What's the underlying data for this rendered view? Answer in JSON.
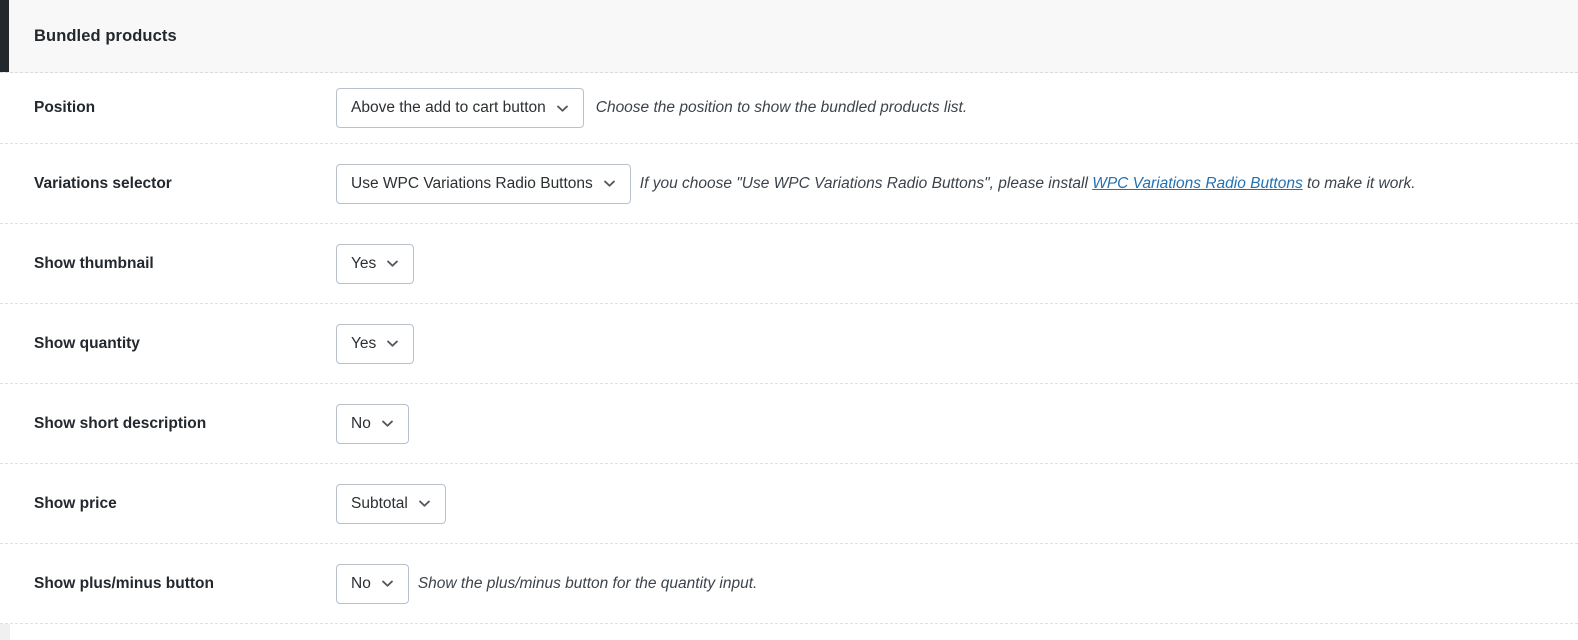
{
  "panel": {
    "title": "Bundled products",
    "accent_color": "#23282d",
    "header_background": "#f8f8f8",
    "link_color": "#2271b1"
  },
  "rows": [
    {
      "label": "Position",
      "select_value": "Above the add to cart button",
      "help_prefix": "Choose the position to show the bundled products list.",
      "help_link": "",
      "help_suffix": ""
    },
    {
      "label": "Variations selector",
      "select_value": "Use WPC Variations Radio Buttons",
      "help_prefix": "If you choose \"Use WPC Variations Radio Buttons\", please install ",
      "help_link": "WPC Variations Radio Buttons",
      "help_suffix": " to make it work."
    },
    {
      "label": "Show thumbnail",
      "select_value": "Yes",
      "help_prefix": "",
      "help_link": "",
      "help_suffix": ""
    },
    {
      "label": "Show quantity",
      "select_value": "Yes",
      "help_prefix": "",
      "help_link": "",
      "help_suffix": ""
    },
    {
      "label": "Show short description",
      "select_value": "No",
      "help_prefix": "",
      "help_link": "",
      "help_suffix": ""
    },
    {
      "label": "Show price",
      "select_value": "Subtotal",
      "help_prefix": "",
      "help_link": "",
      "help_suffix": ""
    },
    {
      "label": "Show plus/minus button",
      "select_value": "No",
      "help_prefix": "Show the plus/minus button for the quantity input.",
      "help_link": "",
      "help_suffix": ""
    }
  ],
  "icons": {
    "chevron": "chevron-down-icon"
  }
}
